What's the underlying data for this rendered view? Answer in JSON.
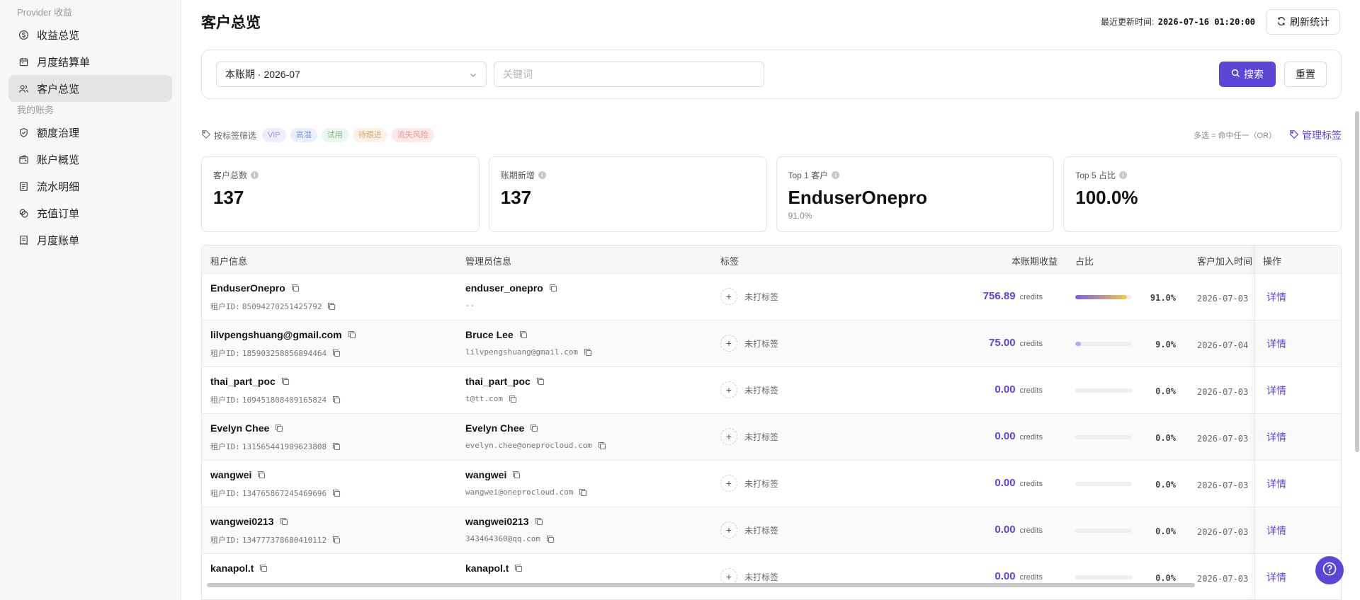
{
  "sidebar": {
    "group1": "Provider 收益",
    "items1": [
      {
        "label": "收益总览",
        "icon": "dollar-circle-icon"
      },
      {
        "label": "月度结算单",
        "icon": "calendar-icon"
      },
      {
        "label": "客户总览",
        "icon": "users-icon",
        "active": true
      }
    ],
    "group2": "我的账务",
    "items2": [
      {
        "label": "额度治理",
        "icon": "shield-check-icon"
      },
      {
        "label": "账户概览",
        "icon": "wallet-icon"
      },
      {
        "label": "流水明细",
        "icon": "document-icon"
      },
      {
        "label": "充值订单",
        "icon": "coins-icon"
      },
      {
        "label": "月度账单",
        "icon": "receipt-icon"
      }
    ]
  },
  "header": {
    "title": "客户总览",
    "updated_label": "最近更新时间:",
    "updated_time": "2026-07-16 01:20:00",
    "refresh_label": "刷新统计"
  },
  "search": {
    "period_value": "本账期 · 2026-07",
    "keyword_placeholder": "关键词",
    "search_label": "搜索",
    "reset_label": "重置"
  },
  "tag_filter": {
    "label": "按标签筛选",
    "tags": [
      {
        "label": "VIP",
        "bg": "#f0edfb",
        "fg": "#9a8ce0"
      },
      {
        "label": "高潜",
        "bg": "#eaf0fb",
        "fg": "#7e98d3"
      },
      {
        "label": "试用",
        "bg": "#eaf6ee",
        "fg": "#85b795"
      },
      {
        "label": "待跟进",
        "bg": "#fbf1e6",
        "fg": "#d6a876"
      },
      {
        "label": "流失风险",
        "bg": "#fde9e9",
        "fg": "#e69494"
      }
    ],
    "hint": "多选 = 命中任一（OR）",
    "manage_label": "管理标签"
  },
  "stats": [
    {
      "label": "客户总数",
      "value": "137",
      "sub": ""
    },
    {
      "label": "账期新增",
      "value": "137",
      "sub": ""
    },
    {
      "label": "Top 1 客户",
      "value": "EnduserOnepro",
      "sub": "91.0%"
    },
    {
      "label": "Top 5 占比",
      "value": "100.0%",
      "sub": ""
    }
  ],
  "table": {
    "columns": [
      "租户信息",
      "管理员信息",
      "标签",
      "本账期收益",
      "占比",
      "客户加入时间",
      "操作"
    ],
    "id_prefix": "租户ID:",
    "untagged_label": "未打标签",
    "unit": "credits",
    "detail_label": "详情",
    "rows": [
      {
        "tenant": "EnduserOnepro",
        "tenant_id": "85094270251425792",
        "admin": "enduser_onepro",
        "admin_email": "--",
        "income": "756.89",
        "share": 0.91,
        "share_text": "91.0%",
        "joined": "2026-07-03"
      },
      {
        "tenant": "lilvpengshuang@gmail.com",
        "tenant_id": "185903258856894464",
        "admin": "Bruce Lee",
        "admin_email": "lilvpengshuang@gmail.com",
        "income": "75.00",
        "share": 0.09,
        "share_text": "9.0%",
        "joined": "2026-07-04"
      },
      {
        "tenant": "thai_part_poc",
        "tenant_id": "109451808409165824",
        "admin": "thai_part_poc",
        "admin_email": "t@tt.com",
        "income": "0.00",
        "share": 0,
        "share_text": "0.0%",
        "joined": "2026-07-03"
      },
      {
        "tenant": "Evelyn Chee",
        "tenant_id": "131565441989623808",
        "admin": "Evelyn Chee",
        "admin_email": "evelyn.chee@oneprocloud.com",
        "income": "0.00",
        "share": 0,
        "share_text": "0.0%",
        "joined": "2026-07-03"
      },
      {
        "tenant": "wangwei",
        "tenant_id": "134765867245469696",
        "admin": "wangwei",
        "admin_email": "wangwei@oneprocloud.com",
        "income": "0.00",
        "share": 0,
        "share_text": "0.0%",
        "joined": "2026-07-03"
      },
      {
        "tenant": "wangwei0213",
        "tenant_id": "134777378680410112",
        "admin": "wangwei0213",
        "admin_email": "343464360@qq.com",
        "income": "0.00",
        "share": 0,
        "share_text": "0.0%",
        "joined": "2026-07-03"
      },
      {
        "tenant": "kanapol.t",
        "tenant_id": "",
        "admin": "kanapol.t",
        "admin_email": "",
        "income": "0.00",
        "share": 0,
        "share_text": "0.0%",
        "joined": "2026-07-03"
      }
    ]
  },
  "colors": {
    "accent": "#5b47d6",
    "bar_start": "#7b5ce8",
    "bar_end": "#f2c94c"
  }
}
